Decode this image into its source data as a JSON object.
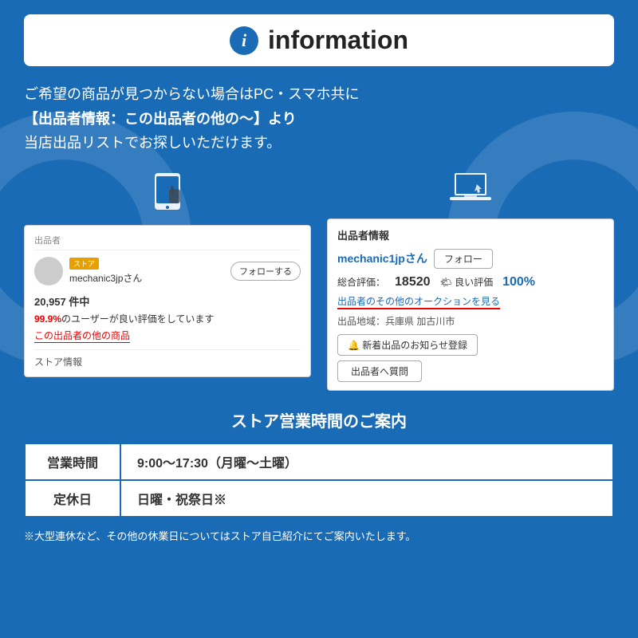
{
  "header": {
    "icon_label": "i",
    "title": "information"
  },
  "main_text": {
    "line1": "ご希望の商品が見つからない場合はPC・スマホ共に",
    "line2": "【出品者情報：この出品者の他の〜】より",
    "line3": "当店出品リストでお探しいただけます。"
  },
  "mobile_screenshot": {
    "seller_label": "出品者",
    "store_badge": "ストア",
    "seller_name": "mechanic3jpさん",
    "follow_btn": "フォローする",
    "count_text": "20,957 件中",
    "positive_text": "99.9%のユーザーが良い評価をしています",
    "other_items_link": "この出品者の他の商品",
    "store_info_label": "ストア情報"
  },
  "pc_screenshot": {
    "seller_info_label": "出品者情報",
    "seller_name": "mechanic1jpさん",
    "follow_btn": "フォロー",
    "rating_label": "総合評価：",
    "rating_num": "18520",
    "good_label": "🌤 良い評価",
    "good_pct": "100%",
    "auction_link": "出品者のその他のオークションを見る",
    "location_label": "出品地域：兵庫県 加古川市",
    "notify_btn": "🔔 新着出品のお知らせ登録",
    "question_btn": "出品者へ質問"
  },
  "store_hours": {
    "section_title": "ストア営業時間のご案内",
    "rows": [
      {
        "label": "営業時間",
        "value": "9:00〜17:30（月曜〜土曜）"
      },
      {
        "label": "定休日",
        "value": "日曜・祝祭日※"
      }
    ]
  },
  "footer_note": "※大型連休など、その他の休業日についてはストア自己紹介にてご案内いたします。",
  "device_icons": {
    "mobile": "📱",
    "pc": "💻"
  }
}
